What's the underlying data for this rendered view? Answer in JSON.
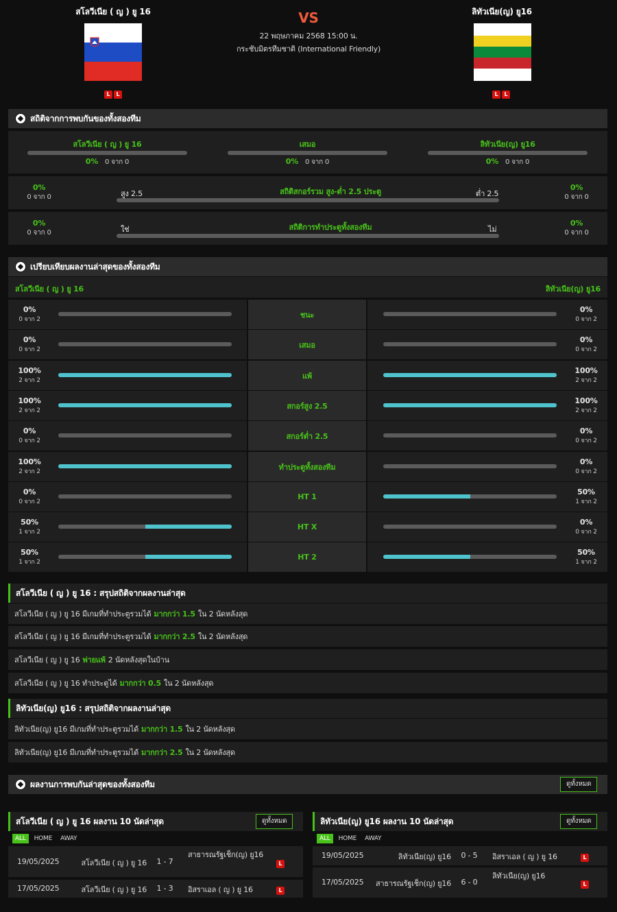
{
  "header": {
    "home_team": "สโลวีเนีย ( ญ ) ยู 16",
    "away_team": "ลิทัวเนีย(ญ) ยู16",
    "vs": "VS",
    "date": "22 พฤษภาคม 2568 15:00 น.",
    "competition": "กระชับมิตรทีมชาติ (International Friendly)",
    "home_form": [
      "L",
      "L"
    ],
    "away_form": [
      "L",
      "L"
    ]
  },
  "h2h": {
    "title": "สถิติจากการพบกันของทั้งสองทีม",
    "home_label": "สโลวีเนีย ( ญ ) ยู 16",
    "draw_label": "เสมอ",
    "away_label": "ลิทัวเนีย(ญ) ยู16",
    "home_pct": "0%",
    "home_of": "0 จาก 0",
    "draw_pct": "0%",
    "draw_of": "0 จาก 0",
    "away_pct": "0%",
    "away_of": "0 จาก 0",
    "ou": {
      "title": "สถิติสกอร์รวม สูง-ต่ำ 2.5 ประตู",
      "left": "สูง 2.5",
      "right": "ต่ำ 2.5",
      "lpct": "0%",
      "lof": "0 จาก 0",
      "rpct": "0%",
      "rof": "0 จาก 0"
    },
    "btts": {
      "title": "สถิติการทำประตูทั้งสองทีม",
      "left": "ใช่",
      "right": "ไม่",
      "lpct": "0%",
      "lof": "0 จาก 0",
      "rpct": "0%",
      "rof": "0 จาก 0"
    }
  },
  "compare": {
    "title": "เปรียบเทียบผลงานล่าสุดของทั้งสองทีม",
    "home": "สโลวีเนีย ( ญ ) ยู 16",
    "away": "ลิทัวเนีย(ญ) ยู16",
    "rows": [
      {
        "label": "ชนะ",
        "hp": "0%",
        "ho": "0 จาก 2",
        "hv": 0,
        "ap": "0%",
        "ao": "0 จาก 2",
        "av": 0
      },
      {
        "label": "เสมอ",
        "hp": "0%",
        "ho": "0 จาก 2",
        "hv": 0,
        "ap": "0%",
        "ao": "0 จาก 2",
        "av": 0
      },
      {
        "label": "แพ้",
        "hp": "100%",
        "ho": "2 จาก 2",
        "hv": 1,
        "ap": "100%",
        "ao": "2 จาก 2",
        "av": 1
      },
      {
        "label": "สกอร์สูง 2.5",
        "hp": "100%",
        "ho": "2 จาก 2",
        "hv": 1,
        "ap": "100%",
        "ao": "2 จาก 2",
        "av": 1
      },
      {
        "label": "สกอร์ต่ำ 2.5",
        "hp": "0%",
        "ho": "0 จาก 2",
        "hv": 0,
        "ap": "0%",
        "ao": "0 จาก 2",
        "av": 0
      },
      {
        "label": "ทำประตูทั้งสองทีม",
        "hp": "100%",
        "ho": "2 จาก 2",
        "hv": 1,
        "ap": "0%",
        "ao": "0 จาก 2",
        "av": 0
      },
      {
        "label": "HT 1",
        "hp": "0%",
        "ho": "0 จาก 2",
        "hv": 0,
        "ap": "50%",
        "ao": "1 จาก 2",
        "av": 0.5
      },
      {
        "label": "HT X",
        "hp": "50%",
        "ho": "1 จาก 2",
        "hv": 0.5,
        "ap": "0%",
        "ao": "0 จาก 2",
        "av": 0
      },
      {
        "label": "HT 2",
        "hp": "50%",
        "ho": "1 จาก 2",
        "hv": 0.5,
        "ap": "50%",
        "ao": "1 จาก 2",
        "av": 0.5
      }
    ]
  },
  "home_summary": {
    "title": "สโลวีเนีย ( ญ ) ยู 16 : สรุปสถิติจากผลงานล่าสุด",
    "lines": [
      {
        "a": "สโลวีเนีย ( ญ ) ยู 16 มีเกมที่ทำประตูรวมได้",
        "hl": "มากกว่า 1.5",
        "b": "ใน 2 นัดหลังสุด"
      },
      {
        "a": "สโลวีเนีย ( ญ ) ยู 16 มีเกมที่ทำประตูรวมได้",
        "hl": "มากกว่า 2.5",
        "b": "ใน 2 นัดหลังสุด"
      },
      {
        "a": "สโลวีเนีย ( ญ ) ยู 16",
        "hl": "พ่ายแพ้",
        "b": "2 นัดหลังสุดในบ้าน"
      },
      {
        "a": "สโลวีเนีย ( ญ ) ยู 16 ทำประตูได้",
        "hl": "มากกว่า 0.5",
        "b": "ใน 2 นัดหลังสุด"
      }
    ]
  },
  "away_summary": {
    "title": "ลิทัวเนีย(ญ) ยู16 : สรุปสถิติจากผลงานล่าสุด",
    "lines": [
      {
        "a": "ลิทัวเนีย(ญ) ยู16 มีเกมที่ทำประตูรวมได้",
        "hl": "มากกว่า 1.5",
        "b": "ใน 2 นัดหลังสุด"
      },
      {
        "a": "ลิทัวเนีย(ญ) ยู16 มีเกมที่ทำประตูรวมได้",
        "hl": "มากกว่า 2.5",
        "b": "ใน 2 นัดหลังสุด"
      }
    ]
  },
  "recent_h2h": {
    "title": "ผลงานการพบกันล่าสุดของทั้งสองทีม",
    "btn": "ดูทั้งหมด"
  },
  "home_last": {
    "title": "สโลวีเนีย ( ญ ) ยู 16 ผลงาน 10 นัดล่าสุด",
    "btn": "ดูทั้งหมด",
    "tabs": [
      "ALL",
      "HOME",
      "AWAY"
    ],
    "matches": [
      {
        "date": "19/05/2025",
        "home": "สโลวีเนีย ( ญ ) ยู 16",
        "score": "1 - 7",
        "away": "สาธารณรัฐเช็ก(ญ) ยู16",
        "res": "L"
      },
      {
        "date": "17/05/2025",
        "home": "สโลวีเนีย ( ญ ) ยู 16",
        "score": "1 - 3",
        "away": "อิสราเอล ( ญ ) ยู 16",
        "res": "L"
      }
    ]
  },
  "away_last": {
    "title": "ลิทัวเนีย(ญ) ยู16 ผลงาน 10 นัดล่าสุด",
    "btn": "ดูทั้งหมด",
    "tabs": [
      "ALL",
      "HOME",
      "AWAY"
    ],
    "matches": [
      {
        "date": "19/05/2025",
        "home": "ลิทัวเนีย(ญ) ยู16",
        "score": "0 - 5",
        "away": "อิสราเอล ( ญ ) ยู 16",
        "res": "L"
      },
      {
        "date": "17/05/2025",
        "home": "สาธารณรัฐเช็ก(ญ) ยู16",
        "score": "6 - 0",
        "away": "ลิทัวเนีย(ญ) ยู16",
        "res": "L"
      }
    ]
  },
  "colors": {
    "accent": "#48c21a",
    "bar_fill": "#4fc3cd",
    "loss": "#d5120f",
    "vs": "#ef5a3c"
  }
}
